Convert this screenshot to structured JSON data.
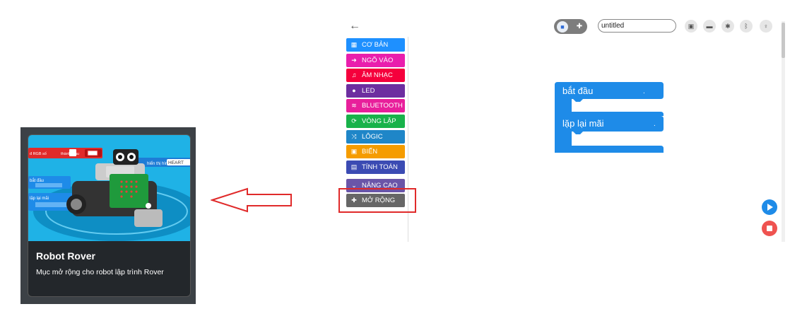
{
  "extension_card": {
    "title": "Robot Rover",
    "description": "Mục mở rộng cho robot lập trình Rover",
    "image_labels": {
      "rgb": "đ RGB số",
      "color": "thành màu",
      "show": "hiển thị hình ảnh",
      "icon": "HEART",
      "start": "bắt đầu",
      "forever": "lặp lại mãi"
    }
  },
  "nav": {
    "back_icon": "arrow-left-icon"
  },
  "toolbox": {
    "categories": [
      {
        "label": "CƠ BẢN",
        "color": "#1e90ff",
        "icon": "grid-icon",
        "glyph": "▦"
      },
      {
        "label": "NGÕ VÀO",
        "color": "#e91ead",
        "icon": "input-icon",
        "glyph": "➜"
      },
      {
        "label": "ÂM NHẠC",
        "color": "#f5003c",
        "icon": "music-icon",
        "glyph": "♫"
      },
      {
        "label": "LED",
        "color": "#6d2ea0",
        "icon": "bulb-icon",
        "glyph": "●"
      },
      {
        "label": "BLUETOOTH",
        "color": "#e81f9b",
        "icon": "wifi-icon",
        "glyph": "≋"
      },
      {
        "label": "VÒNG LẶP",
        "color": "#18b24a",
        "icon": "loop-icon",
        "glyph": "⟳"
      },
      {
        "label": "LÔGIC",
        "color": "#1f86c8",
        "icon": "shuffle-icon",
        "glyph": "⤨"
      },
      {
        "label": "BIẾN",
        "color": "#f59c00",
        "icon": "save-icon",
        "glyph": "▣"
      },
      {
        "label": "TÍNH TOÁN",
        "color": "#3b4bb3",
        "icon": "calculator-icon",
        "glyph": "▤"
      }
    ],
    "advanced": {
      "label": "NÂNG CAO",
      "color": "#6a55a8",
      "icon": "chevron-down-icon",
      "glyph": "⌄"
    },
    "extensions": {
      "label": "MỞ RỘNG",
      "color": "#666666",
      "icon": "plus-icon",
      "glyph": "✚"
    }
  },
  "toolbar": {
    "project_name": "untitled",
    "icons": [
      "save-icon",
      "folder-icon",
      "gear-icon",
      "bluetooth-icon",
      "lightbulb-icon"
    ]
  },
  "workspace": {
    "blocks": [
      {
        "label": "bắt đầu"
      },
      {
        "label": "lặp lại mãi"
      }
    ]
  },
  "colors": {
    "block": "#1e8be8",
    "highlight": "#e02a2a"
  }
}
